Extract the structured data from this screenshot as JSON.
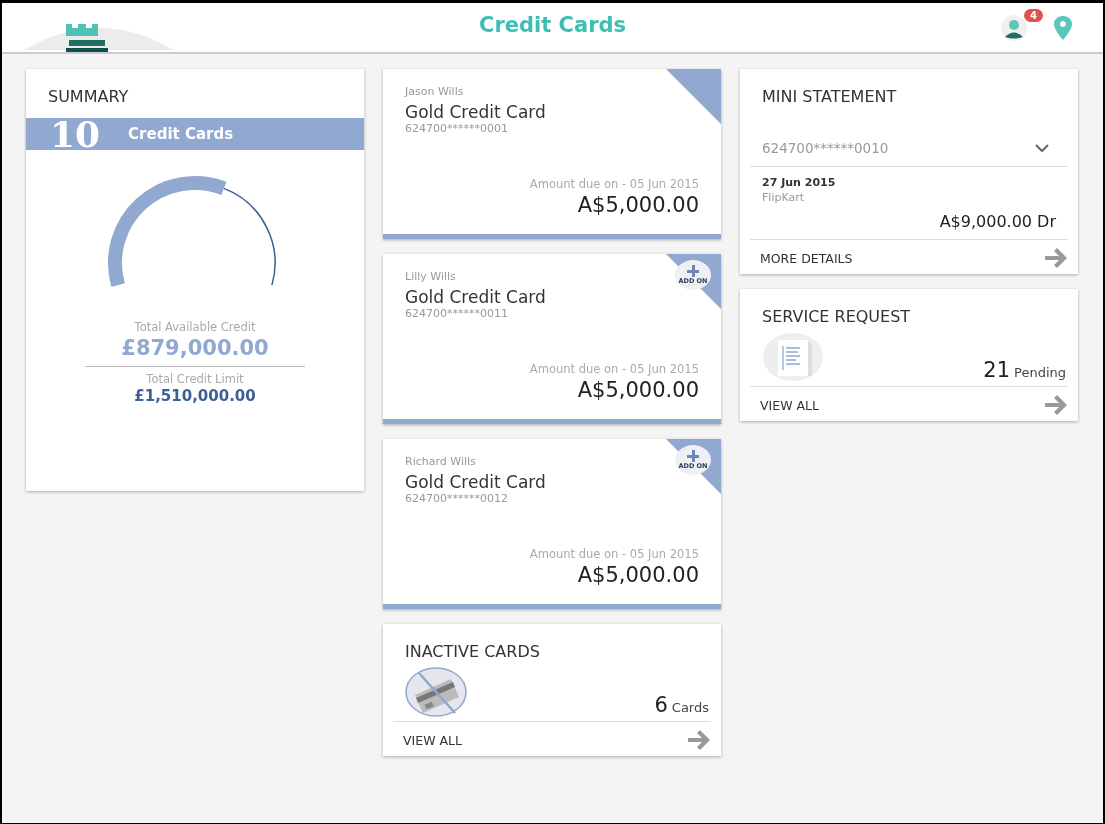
{
  "header": {
    "title": "Credit Cards",
    "notification_count": "4"
  },
  "summary": {
    "title": "SUMMARY",
    "count": "10",
    "count_label": "Credit Cards",
    "available_label": "Total Available Credit",
    "available": "£879,000.00",
    "limit_label": "Total Credit Limit",
    "limit": "£1,510,000.00"
  },
  "cards": [
    {
      "holder": "Jason Wills",
      "name": "Gold Credit Card",
      "number": "624700******0001",
      "due_label": "Amount due on - 05 Jun 2015",
      "amount": "A$5,000.00",
      "add_on": false
    },
    {
      "holder": "Lilly Wills",
      "name": "Gold Credit Card",
      "number": "624700******0011",
      "due_label": "Amount due on - 05 Jun 2015",
      "amount": "A$5,000.00",
      "add_on": true,
      "add_on_label": "ADD ON"
    },
    {
      "holder": "Richard Wills",
      "name": "Gold Credit Card",
      "number": "624700******0012",
      "due_label": "Amount due on - 05 Jun 2015",
      "amount": "A$5,000.00",
      "add_on": true,
      "add_on_label": "ADD ON"
    }
  ],
  "inactive": {
    "title": "INACTIVE CARDS",
    "count": "6",
    "unit": "Cards",
    "link": "VIEW ALL"
  },
  "mini_statement": {
    "title": "MINI STATEMENT",
    "account": "624700******0010",
    "date": "27 Jun 2015",
    "merchant": "FlipKart",
    "amount": "A$9,000.00 Dr",
    "link": "MORE DETAILS"
  },
  "service_request": {
    "title": "SERVICE REQUEST",
    "count": "21",
    "unit": "Pending",
    "link": "VIEW ALL"
  }
}
